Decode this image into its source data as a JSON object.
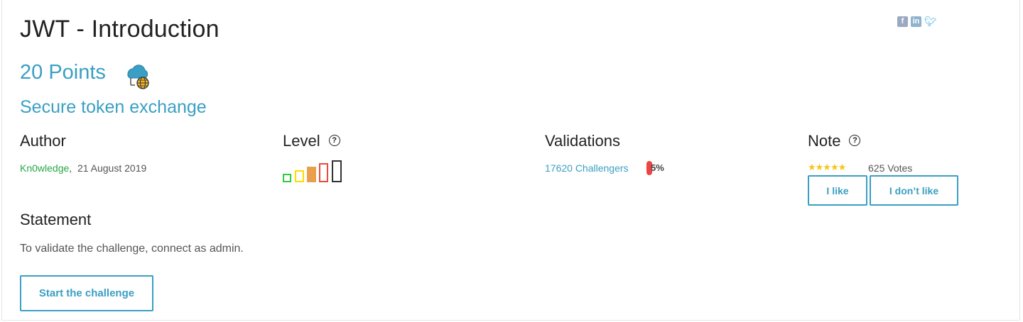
{
  "challenge": {
    "title": "JWT - Introduction",
    "points": "20 Points",
    "category_icon": "web-server-icon",
    "subtitle": "Secure token exchange"
  },
  "social": {
    "facebook": "f",
    "linkedin": "in",
    "twitter": "t"
  },
  "author": {
    "heading": "Author",
    "name": "Kn0wledge",
    "separator": ",",
    "date": "21 August 2019"
  },
  "level": {
    "heading": "Level",
    "help": "?",
    "current": 3,
    "max": 5,
    "colors": [
      "#2ecc40",
      "#ffdc00",
      "#e8a04c",
      "#e84c3d",
      "#333333"
    ]
  },
  "validations": {
    "heading": "Validations",
    "challengers": "17620 Challengers",
    "percent": "5%",
    "bar_color": "#ef4444"
  },
  "note": {
    "heading": "Note",
    "help": "?",
    "stars": "★★★★★",
    "votes": "625 Votes",
    "like_label": "I like",
    "dislike_label": "I don’t like"
  },
  "statement": {
    "heading": "Statement",
    "text": "To validate the challenge, connect as admin."
  },
  "actions": {
    "start_label": "Start the challenge"
  },
  "colors": {
    "accent": "#3a9fc3",
    "author": "#28a745"
  }
}
